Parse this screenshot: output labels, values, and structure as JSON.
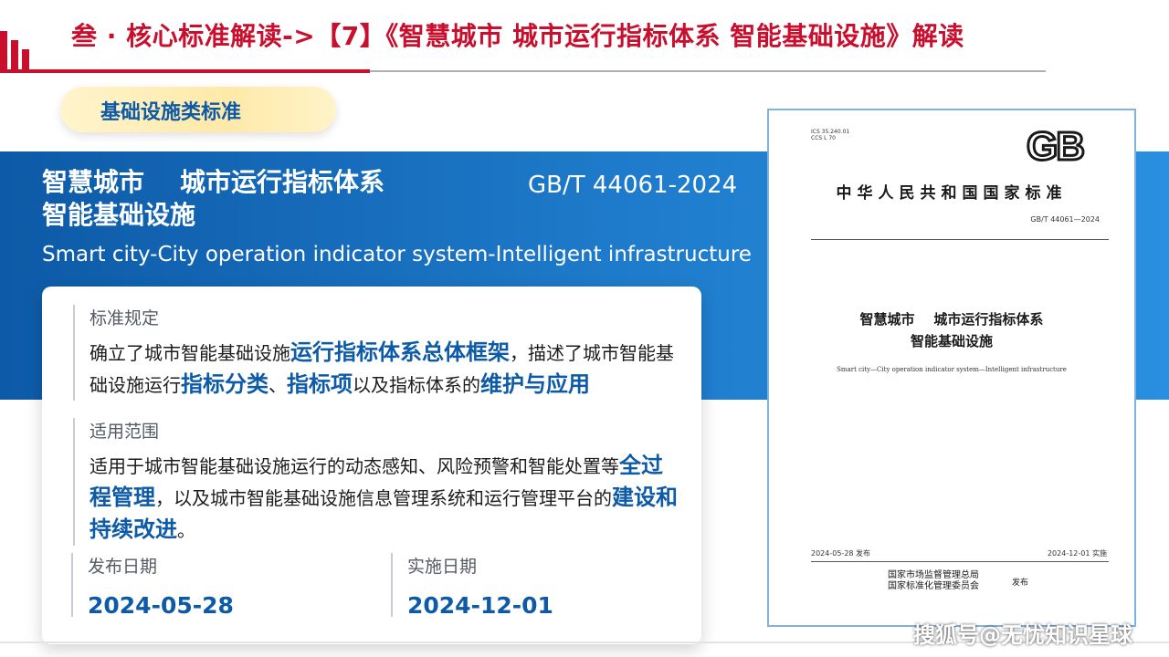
{
  "header": {
    "title": "叁 · 核心标准解读->【7】《智慧城市  城市运行指标体系  智能基础设施》解读"
  },
  "tag": {
    "label": "基础设施类标准"
  },
  "standard": {
    "name_line1": "智慧城市    城市运行指标体系",
    "name_line2": "智能基础设施",
    "number": "GB/T 44061-2024",
    "english": "Smart city-City operation indicator system-Intelligent infrastructure"
  },
  "card": {
    "provisions": {
      "label": "标准规定",
      "t1": "确立了城市智能基础设施",
      "h1": "运行指标体系总体框架",
      "t2": "，描述了城市智能基础设施运行",
      "h2": "指标分类",
      "t3": "、",
      "h3": "指标项",
      "t4": "以及指标体系的",
      "h4": "维护与应用"
    },
    "scope": {
      "label": "适用范围",
      "t1": "适用于城市智能基础设施运行的动态感知、风险预警和智能处置等",
      "h1": "全过程管理",
      "t2": "，以及城市智能基础设施信息管理系统和运行管理平台的",
      "h2": "建设和持续改进",
      "t3": "。"
    },
    "publish": {
      "label": "发布日期",
      "value": "2024-05-28"
    },
    "implement": {
      "label": "实施日期",
      "value": "2024-12-01"
    }
  },
  "doc": {
    "ics": "ICS 35.240.01",
    "ccs": "CCS L 70",
    "logo": "GB",
    "national": "中华人民共和国国家标准",
    "number": "GB/T 44061—2024",
    "title_line1": "智慧城市    城市运行指标体系",
    "title_line2": "智能基础设施",
    "english": "Smart city—City operation indicator system—Intelligent infrastructure",
    "publish": "2024-05-28 发布",
    "implement": "2024-12-01 实施",
    "issuer1": "国家市场监督管理总局",
    "issuer2": "国家标准化管理委员会",
    "issue": "发布"
  },
  "watermark": "搜狐号@无忧知识星球",
  "colors": {
    "red": "#c8102e",
    "blue": "#0d5aa7",
    "band": "#1f7ccc",
    "tag": "#ffe9a8"
  }
}
